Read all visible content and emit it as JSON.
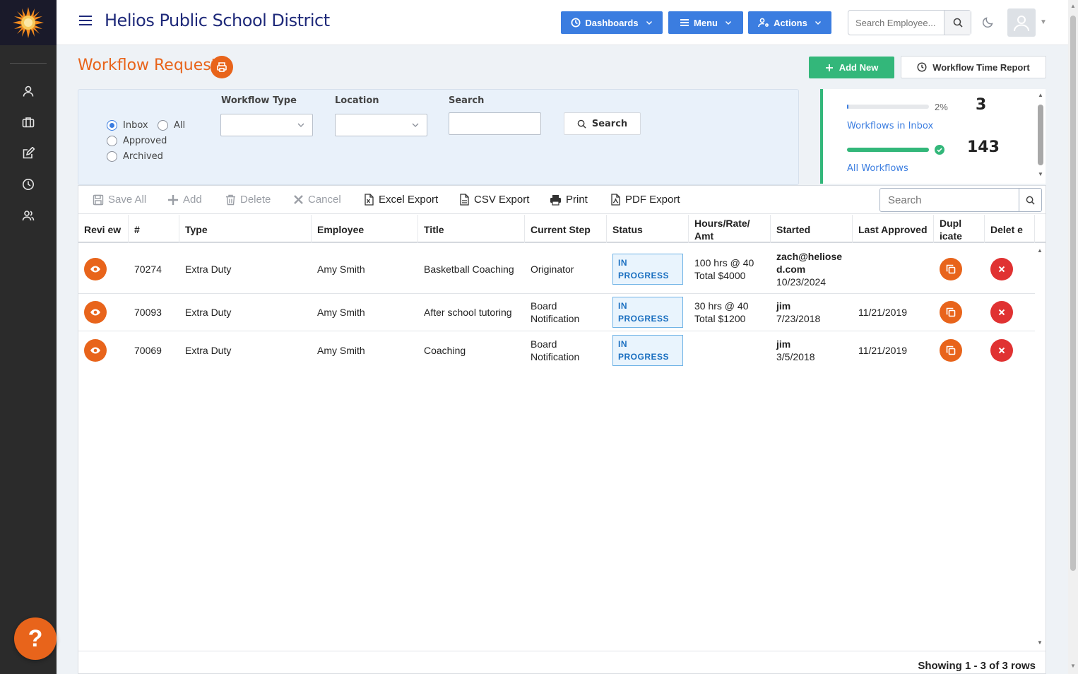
{
  "header": {
    "title": "Helios Public School District",
    "dashboards_label": "Dashboards",
    "menu_label": "Menu",
    "actions_label": "Actions",
    "search_placeholder": "Search Employee..."
  },
  "page": {
    "title": "Workflow Requests",
    "add_new_label": "Add New",
    "time_report_label": "Workflow Time Report"
  },
  "filters": {
    "radio_inbox": "Inbox",
    "radio_all": "All",
    "radio_approved": "Approved",
    "radio_archived": "Archived",
    "selected_radio": "Inbox",
    "workflow_type_label": "Workflow Type",
    "workflow_type_value": "",
    "location_label": "Location",
    "location_value": "",
    "search_label": "Search",
    "search_value": "",
    "search_button": "Search"
  },
  "stats": {
    "inbox_percent": "2%",
    "inbox_fraction": 0.02,
    "inbox_count": "3",
    "inbox_link": "Workflows in Inbox",
    "all_fraction": 1.0,
    "all_count": "143",
    "all_link": "All Workflows"
  },
  "toolbar": {
    "save_all": "Save All",
    "add": "Add",
    "delete": "Delete",
    "cancel": "Cancel",
    "excel_export": "Excel Export",
    "csv_export": "CSV Export",
    "print": "Print",
    "pdf_export": "PDF Export",
    "search_placeholder": "Search"
  },
  "table": {
    "headers": {
      "review": "Revi ew",
      "number": "#",
      "type": "Type",
      "employee": "Employee",
      "title": "Title",
      "current_step": "Current Step",
      "status": "Status",
      "hours": "Hours/Rate/ Amt",
      "started": "Started",
      "last_approved": "Last Approved",
      "duplicate": "Dupl icate",
      "delete": "Delet e"
    },
    "rows": [
      {
        "number": "70274",
        "type": "Extra Duty",
        "employee": "Amy Smith",
        "title": "Basketball Coaching",
        "step_line1": "Originator",
        "step_line2": "",
        "status": "IN PROGRESS",
        "hours_line1": "100 hrs @ 40",
        "hours_line2": "Total $4000",
        "started_by": "zach@heliosed.com",
        "started_date": "10/23/2024",
        "last_approved": ""
      },
      {
        "number": "70093",
        "type": "Extra Duty",
        "employee": "Amy Smith",
        "title": "After school tutoring",
        "step_line1": "Board",
        "step_line2": "Notification",
        "status": "IN PROGRESS",
        "hours_line1": "30 hrs @ 40",
        "hours_line2": "Total $1200",
        "started_by": "jim",
        "started_date": "7/23/2018",
        "last_approved": "11/21/2019"
      },
      {
        "number": "70069",
        "type": "Extra Duty",
        "employee": "Amy Smith",
        "title": "Coaching",
        "step_line1": "Board",
        "step_line2": "Notification",
        "status": "IN PROGRESS",
        "hours_line1": "",
        "hours_line2": "",
        "started_by": "jim",
        "started_date": "3/5/2018",
        "last_approved": "11/21/2019"
      }
    ],
    "footer": "Showing 1 - 3 of 3 rows"
  },
  "help": {
    "label": "?"
  },
  "colors": {
    "accent_orange": "#e8641b",
    "nav_blue": "#3b7de0",
    "title_navy": "#1f2a7a",
    "success_green": "#33b77a",
    "danger_red": "#e03232",
    "sidebar_dark": "#2b2b2b"
  },
  "icons": {
    "sidebar": [
      "person-icon",
      "briefcase-icon",
      "edit-icon",
      "clock-icon",
      "people-icon"
    ]
  }
}
